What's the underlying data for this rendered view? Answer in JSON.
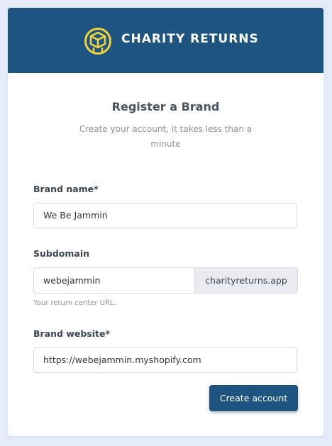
{
  "brand": {
    "name": "CHARITY RETURNS",
    "logo_icon": "box-in-circle-logo",
    "header_color": "#1e5580",
    "accent_color": "#f2d23c"
  },
  "form": {
    "title": "Register a Brand",
    "subtitle": "Create your account, it takes less than a minute",
    "brand_name": {
      "label": "Brand name*",
      "value": "We Be Jammin"
    },
    "subdomain": {
      "label": "Subdomain",
      "value": "webejammin",
      "suffix": "charityreturns.app",
      "help": "Your return center URL."
    },
    "brand_website": {
      "label": "Brand website*",
      "value": "https://webejammin.myshopify.com"
    },
    "submit_label": "Create account"
  }
}
